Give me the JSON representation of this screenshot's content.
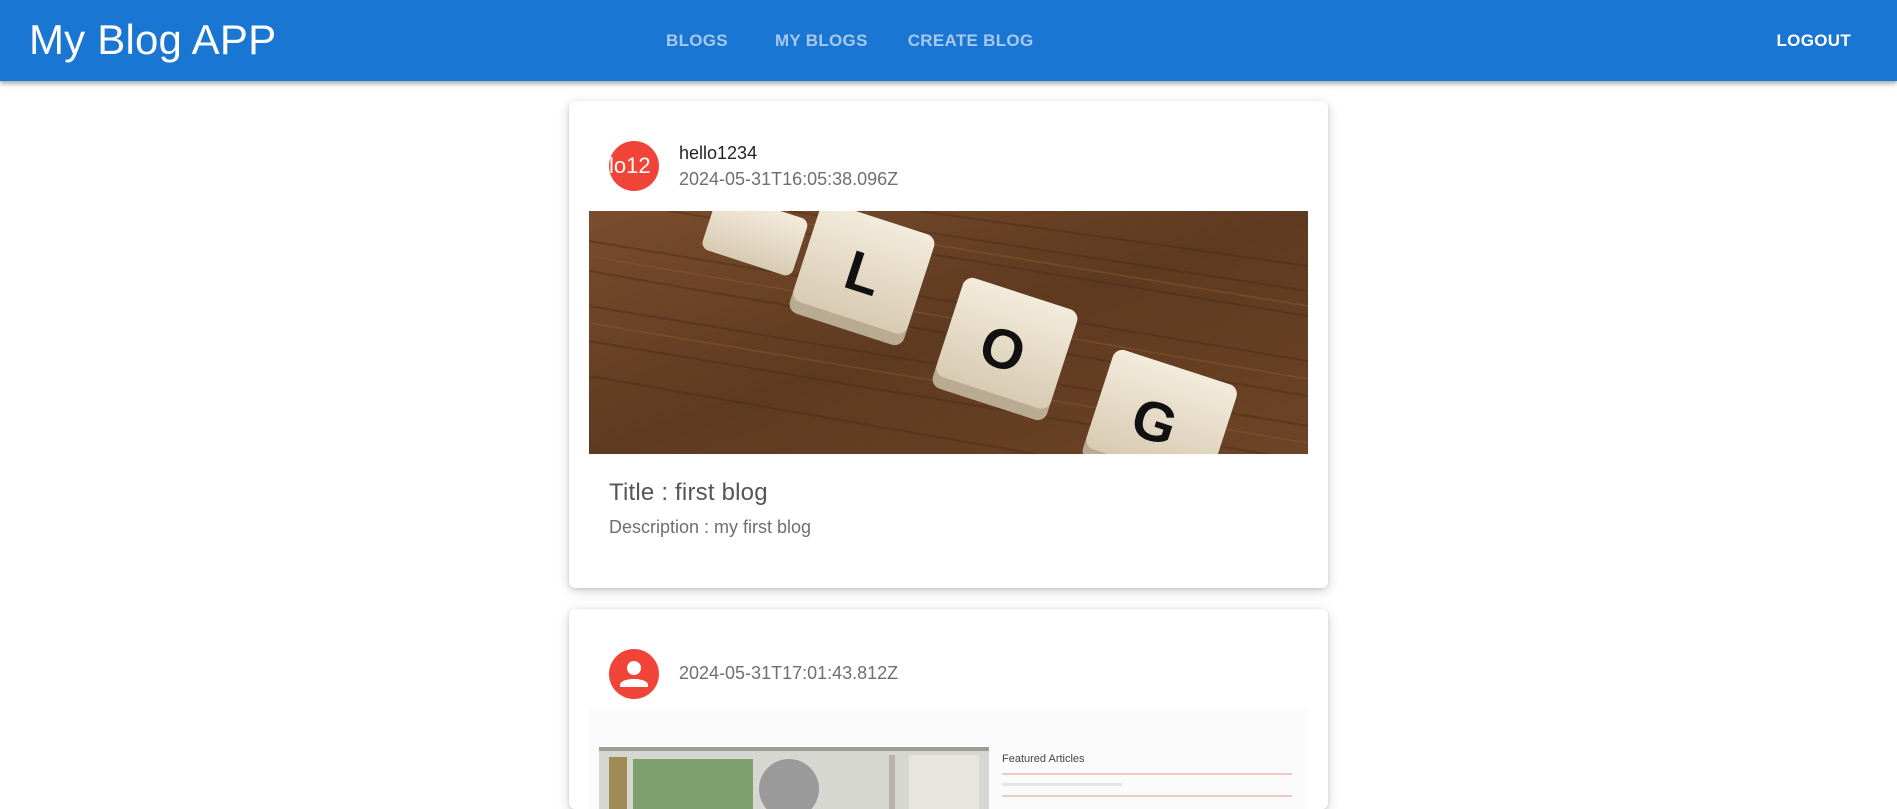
{
  "app": {
    "title": "My Blog APP"
  },
  "nav": {
    "tabs": [
      {
        "label": "BLOGS"
      },
      {
        "label": "MY BLOGS"
      },
      {
        "label": "CREATE BLOG"
      }
    ],
    "logout_label": "LOGOUT"
  },
  "colors": {
    "appbar": "#1976d2",
    "tab_inactive": "#a9c8ee",
    "avatar": "#f04438"
  },
  "posts": [
    {
      "avatar_text": "lo12",
      "user": "hello1234",
      "timestamp": "2024-05-31T16:05:38.096Z",
      "image_tiles": [
        "L",
        "O",
        "G"
      ],
      "title": "Title : first blog",
      "description": "Description : my first blog"
    },
    {
      "avatar_icon": "person-icon",
      "timestamp": "2024-05-31T17:01:43.812Z",
      "image_caption": "Featured Articles"
    }
  ]
}
